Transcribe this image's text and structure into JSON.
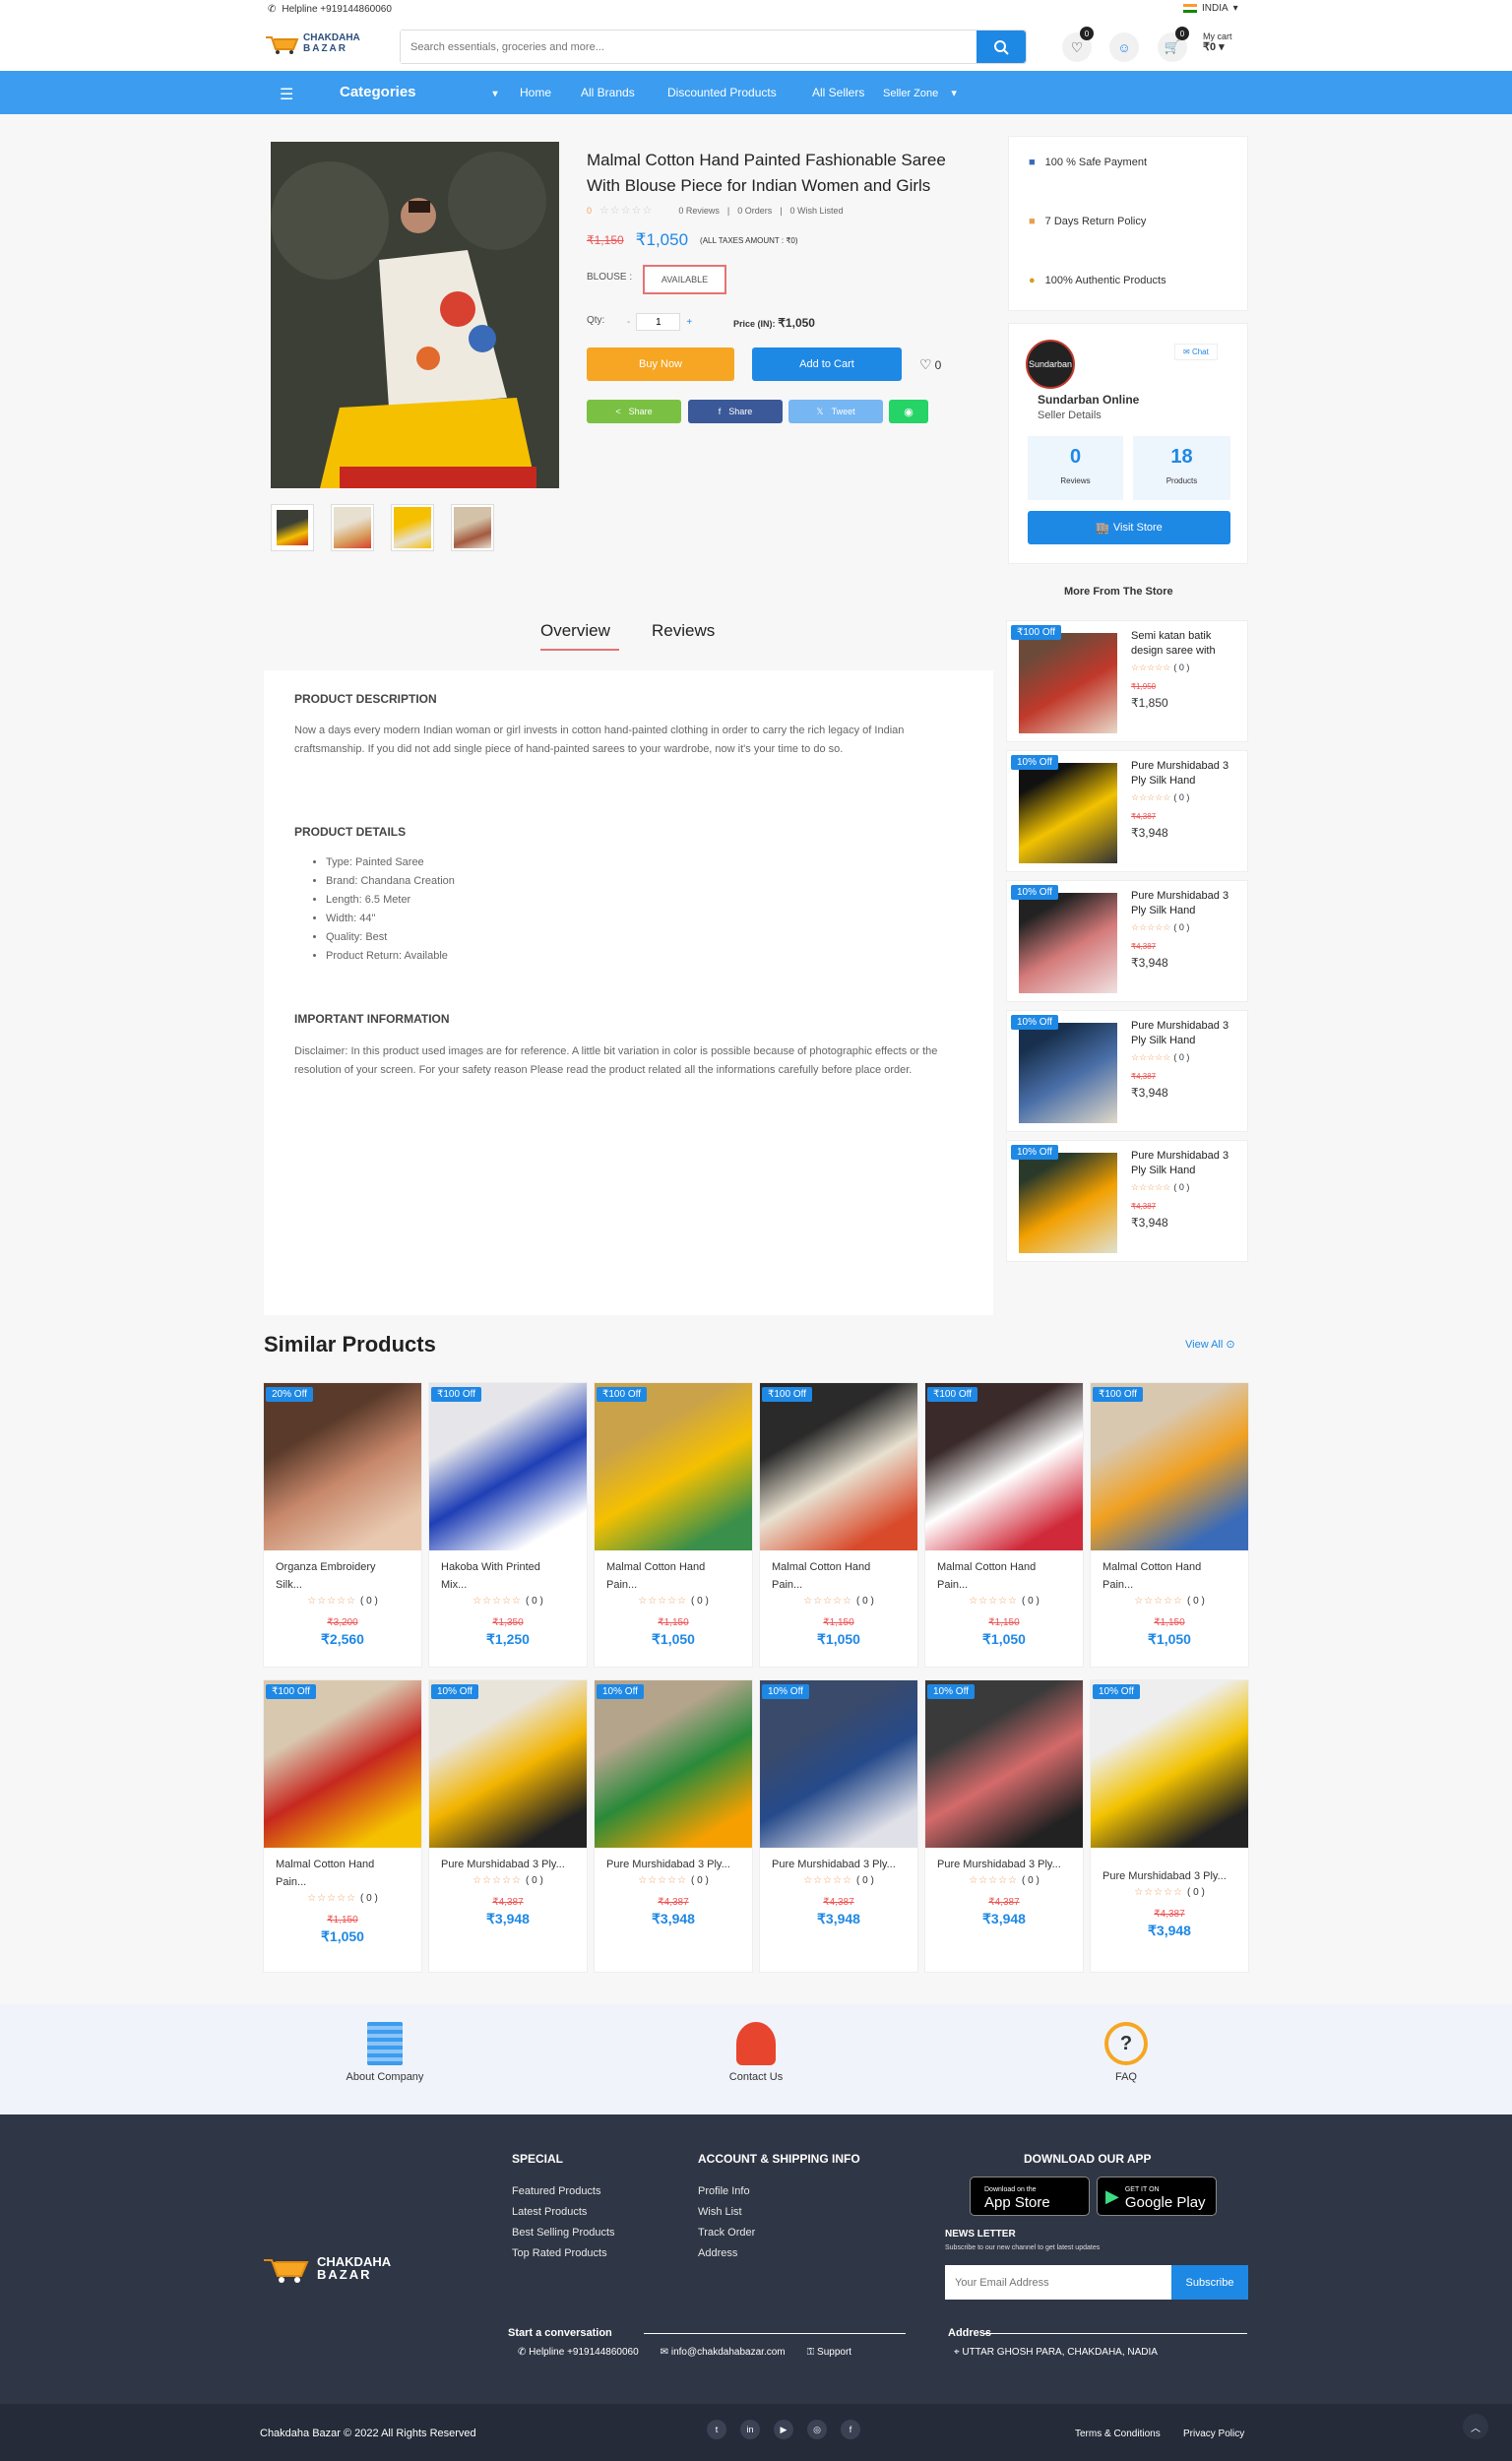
{
  "topbar": {
    "helpline": "Helpline +919144860060",
    "country": "INDIA",
    "search_placeholder": "Search essentials, groceries and more...",
    "wish_count": "0",
    "cart_count": "0",
    "cart_label": "My cart",
    "cart_amount": "₹0"
  },
  "brand": {
    "line1": "CHAKDAHA",
    "line2": "BAZAR"
  },
  "nav": {
    "categories": "Categories",
    "links": [
      "Home",
      "All Brands",
      "Discounted Products",
      "All Sellers",
      "Seller Zone"
    ]
  },
  "product": {
    "title": "Malmal Cotton Hand Painted Fashionable Saree With Blouse Piece for Indian Women and Girls",
    "rating": "0",
    "reviews": "0 Reviews",
    "orders": "0 Orders",
    "wishlisted": "0 Wish Listed",
    "old_price": "₹1,150",
    "price": "₹1,050",
    "tax": "(ALL TAXES AMOUNT : ₹0)",
    "blouse_label": "BLOUSE :",
    "blouse_value": "AVAILABLE",
    "qty_label": "Qty:",
    "qty": "1",
    "price_in_label": "Price (IN):",
    "price_in": "₹1,050",
    "buy_now": "Buy Now",
    "add_to_cart": "Add to Cart",
    "wish_num": "0",
    "share_buttons": [
      "Share",
      "Share",
      "Tweet"
    ]
  },
  "policies": [
    "100 % Safe Payment",
    "7 Days Return Policy",
    "100% Authentic Products"
  ],
  "seller": {
    "chat": "Chat",
    "name": "Sundarban Online",
    "sub": "Seller Details",
    "reviews_num": "0",
    "reviews_label": "Reviews",
    "products_num": "18",
    "products_label": "Products",
    "visit": "Visit Store",
    "logo_text": "Sundarban"
  },
  "store_more": {
    "title": "More From The Store",
    "items": [
      {
        "badge": "₹100 Off",
        "name": "Semi katan batik design saree with",
        "rating": "( 0 )",
        "old": "₹1,950",
        "price": "₹1,850"
      },
      {
        "badge": "10% Off",
        "name": "Pure Murshidabad 3 Ply Silk Hand",
        "rating": "( 0 )",
        "old": "₹4,387",
        "price": "₹3,948"
      },
      {
        "badge": "10% Off",
        "name": "Pure Murshidabad 3 Ply Silk Hand",
        "rating": "( 0 )",
        "old": "₹4,387",
        "price": "₹3,948"
      },
      {
        "badge": "10% Off",
        "name": "Pure Murshidabad 3 Ply Silk Hand",
        "rating": "( 0 )",
        "old": "₹4,387",
        "price": "₹3,948"
      },
      {
        "badge": "10% Off",
        "name": "Pure Murshidabad 3 Ply Silk Hand",
        "rating": "( 0 )",
        "old": "₹4,387",
        "price": "₹3,948"
      }
    ]
  },
  "tabs": [
    "Overview",
    "Reviews"
  ],
  "overview": {
    "h1": "PRODUCT DESCRIPTION",
    "p1": "Now a days every modern Indian woman or girl invests in cotton hand-painted clothing in order to carry  the rich legacy of Indian craftsmanship.  If you did not add single piece of hand-painted sarees to your wardrobe, now it's your time to do so.",
    "h2": "PRODUCT DETAILS",
    "details": [
      "Type: Painted Saree",
      "Brand: Chandana Creation",
      "Length: 6.5 Meter",
      "Width: 44\"",
      "Quality: Best",
      "Product Return: Available"
    ],
    "h3": "IMPORTANT INFORMATION",
    "p3": "Disclaimer: In this product used images are for reference. A little bit variation in color is possible because of photographic effects or the resolution of your screen.  For your safety reason Please read the product related all the informations carefully before place order."
  },
  "similar": {
    "title": "Similar Products",
    "view_all": "View All",
    "row1": [
      {
        "badge": "20% Off",
        "name1": "Organza Embroidery",
        "name2": "Silk...",
        "rating": "( 0 )",
        "old": "₹3,200",
        "price": "₹2,560"
      },
      {
        "badge": "₹100 Off",
        "name1": "Hakoba With Printed",
        "name2": "Mix...",
        "rating": "( 0 )",
        "old": "₹1,350",
        "price": "₹1,250"
      },
      {
        "badge": "₹100 Off",
        "name1": "Malmal Cotton Hand",
        "name2": "Pain...",
        "rating": "( 0 )",
        "old": "₹1,150",
        "price": "₹1,050"
      },
      {
        "badge": "₹100 Off",
        "name1": "Malmal Cotton Hand",
        "name2": "Pain...",
        "rating": "( 0 )",
        "old": "₹1,150",
        "price": "₹1,050"
      },
      {
        "badge": "₹100 Off",
        "name1": "Malmal Cotton Hand",
        "name2": "Pain...",
        "rating": "( 0 )",
        "old": "₹1,150",
        "price": "₹1,050"
      },
      {
        "badge": "₹100 Off",
        "name1": "Malmal Cotton Hand",
        "name2": "Pain...",
        "rating": "( 0 )",
        "old": "₹1,150",
        "price": "₹1,050"
      }
    ],
    "row2": [
      {
        "badge": "₹100 Off",
        "name1": "Malmal Cotton Hand",
        "name2": "Pain...",
        "rating": "( 0 )",
        "old": "₹1,150",
        "price": "₹1,050"
      },
      {
        "badge": "10% Off",
        "name1": "Pure Murshidabad 3 Ply...",
        "name2": "",
        "rating": "( 0 )",
        "old": "₹4,387",
        "price": "₹3,948"
      },
      {
        "badge": "10% Off",
        "name1": "Pure Murshidabad 3 Ply...",
        "name2": "",
        "rating": "( 0 )",
        "old": "₹4,387",
        "price": "₹3,948"
      },
      {
        "badge": "10% Off",
        "name1": "Pure Murshidabad 3 Ply...",
        "name2": "",
        "rating": "( 0 )",
        "old": "₹4,387",
        "price": "₹3,948"
      },
      {
        "badge": "10% Off",
        "name1": "Pure Murshidabad 3 Ply...",
        "name2": "",
        "rating": "( 0 )",
        "old": "₹4,387",
        "price": "₹3,948"
      },
      {
        "badge": "10% Off",
        "name1": "Pure Murshidabad 3 Ply...",
        "name2": "",
        "rating": "( 0 )",
        "old": "₹4,387",
        "price": "₹3,948"
      }
    ]
  },
  "info_links": [
    "About Company",
    "Contact Us",
    "FAQ"
  ],
  "footer": {
    "special_title": "SPECIAL",
    "special": [
      "Featured Products",
      "Latest Products",
      "Best Selling Products",
      "Top Rated Products"
    ],
    "account_title": "ACCOUNT & SHIPPING INFO",
    "account": [
      "Profile Info",
      "Wish List",
      "Track Order",
      "Address"
    ],
    "download_title": "DOWNLOAD OUR APP",
    "appstore_small": "Download on the",
    "appstore": "App Store",
    "gplay_small": "GET IT ON",
    "gplay": "Google Play",
    "newsletter": "NEWS LETTER",
    "newsletter_sub": "Subscribe to our new channel to get latest updates",
    "email_placeholder": "Your Email Address",
    "subscribe": "Subscribe",
    "conv_title": "Start a conversation",
    "helpline": "Helpline +919144860060",
    "email": "info@chakdahabazar.com",
    "support": "Support",
    "address_title": "Address",
    "address": "UTTAR GHOSH PARA, CHAKDAHA, NADIA",
    "copyright": "Chakdaha Bazar © 2022 All Rights Reserved",
    "terms": "Terms & Conditions",
    "privacy": "Privacy Policy"
  },
  "colors": {
    "accent": "#3b9cf0",
    "orange": "#f6a623",
    "footer": "#2f3645"
  }
}
